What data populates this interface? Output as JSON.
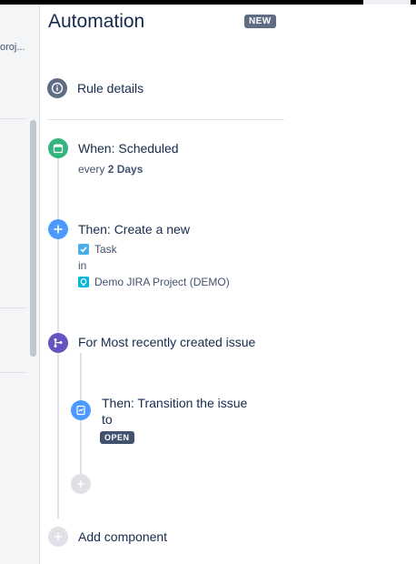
{
  "left_panel": {
    "snippet": "oroj..."
  },
  "header": {
    "title": "Automation",
    "badge": "NEW"
  },
  "rule_details": {
    "label": "Rule details"
  },
  "trigger": {
    "label": "When: Scheduled",
    "every_prefix": "every",
    "every_value": "2 Days",
    "color": "#36b37e"
  },
  "action_create": {
    "label": "Then: Create a new",
    "issue_type": "Task",
    "in_label": "in",
    "project": "Demo JIRA Project (DEMO)",
    "color": "#4c9aff"
  },
  "branch": {
    "label": "For Most recently created issue",
    "color": "#6554c0"
  },
  "transition": {
    "line1": "Then: Transition the issue",
    "line2": "to",
    "status": "OPEN",
    "color": "#4c9aff"
  },
  "add_component": {
    "label": "Add component"
  },
  "icons": [
    "info-icon",
    "calendar-icon",
    "plus-icon",
    "branch-icon",
    "transition-icon",
    "checkbox-icon",
    "project-icon",
    "add-icon"
  ]
}
